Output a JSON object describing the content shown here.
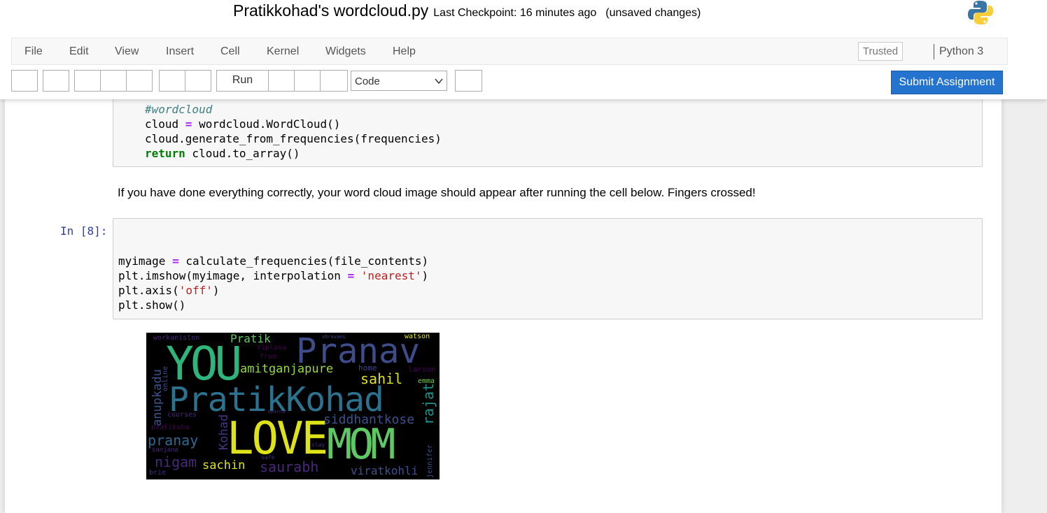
{
  "header": {
    "notebook_name": "Pratikkohad's wordcloud.py",
    "checkpoint": "Last Checkpoint: 16 minutes ago",
    "unsaved": "(unsaved changes)",
    "logo_icon": "python-logo-icon"
  },
  "menu": {
    "items": [
      "File",
      "Edit",
      "View",
      "Insert",
      "Cell",
      "Kernel",
      "Widgets",
      "Help"
    ],
    "trusted": "Trusted",
    "kernel": "Python 3"
  },
  "toolbar": {
    "run_label": "Run",
    "cell_type": "Code",
    "submit_label": "Submit Assignment"
  },
  "cells": {
    "prev_code": {
      "comment": "#wordcloud",
      "line2_a": "cloud ",
      "line2_op": "=",
      "line2_b": " wordcloud.WordCloud()",
      "line3": "cloud.generate_from_frequencies(frequencies)",
      "line4_kw": "return",
      "line4_b": " cloud.to_array()"
    },
    "markdown": "If you have done everything correctly, your word cloud image should appear after running the cell below. Fingers crossed!",
    "in8": {
      "prompt": "In [8]:",
      "l1_a": "myimage ",
      "l1_op": "=",
      "l1_b": " calculate_frequencies(file_contents)",
      "l2_a": "plt.imshow(myimage, interpolation ",
      "l2_op": "=",
      "l2_sp": " ",
      "l2_str": "'nearest'",
      "l2_end": ")",
      "l3_a": "plt.axis(",
      "l3_str": "'off'",
      "l3_end": ")",
      "l4": "plt.show()"
    }
  },
  "wordcloud": {
    "words": [
      "YOU",
      "Pranav",
      "PratikKohad",
      "LOVE",
      "MOM",
      "Pratik",
      "amitganjapure",
      "sahil",
      "siddhantkose",
      "rajat",
      "anupkadu",
      "pranay",
      "nigam",
      "sachin",
      "saurabh",
      "viratkohli",
      "workaniston",
      "viplava",
      "from",
      "home",
      "larson",
      "emma",
      "online",
      "courses",
      "pratiksha",
      "Kohad",
      "sanjana",
      "jennifer",
      "brie",
      "watson",
      "shravani",
      "slay",
      "safe",
      "aparna"
    ]
  }
}
